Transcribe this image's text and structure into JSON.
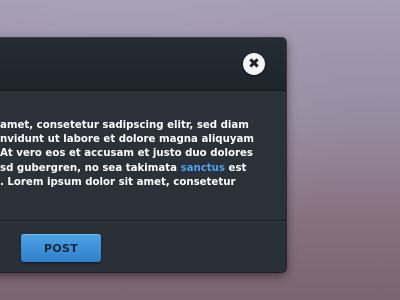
{
  "modal": {
    "close_icon": "close-icon",
    "close_glyph": "✖",
    "body": {
      "lines": [
        "amet, consetetur sadipscing elitr, sed diam",
        "nvidunt ut labore et dolore magna aliquyam",
        "At vero eos et accusam et justo duo dolores",
        "sd gubergren, no sea takimata ",
        " est",
        ". Lorem ipsum dolor sit amet, consetetur"
      ],
      "link_text": "sanctus"
    },
    "footer": {
      "post_label": "POST"
    }
  },
  "colors": {
    "link": "#4aa3ee",
    "button": "#3a8fd8",
    "panel": "#2a3038"
  }
}
